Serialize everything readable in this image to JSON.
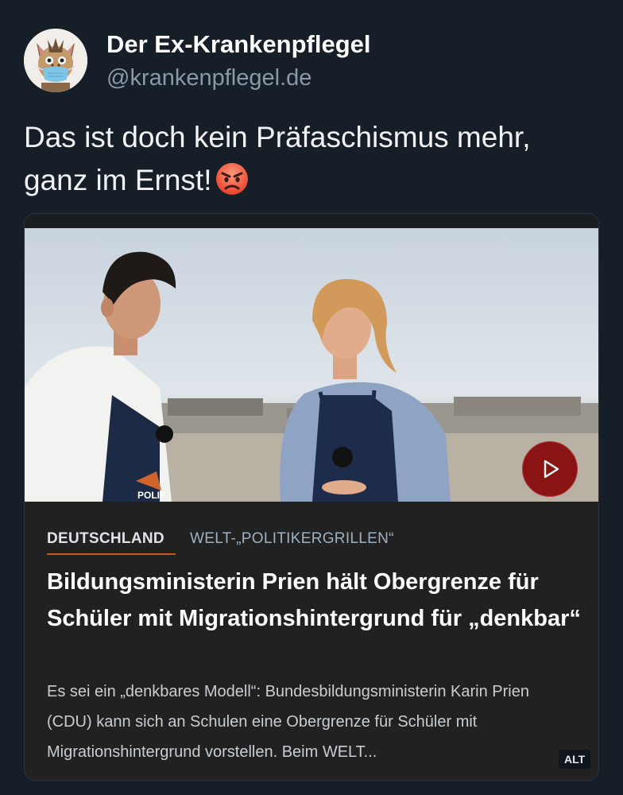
{
  "post": {
    "display_name": "Der Ex-Krankenpflegel",
    "handle": "@krankenpflegel.de",
    "text": "Das ist doch kein Präfaschismus mehr, ganz im Ernst!",
    "emoji": "angry-face-emoji"
  },
  "link_card": {
    "section": "DEUTSCHLAND",
    "subsection": "WELT-„POLITIKERGRILLEN“",
    "headline": "Bildungsministerin Prien hält Obergrenze für Schüler mit Migrationshintergrund für „denkbar“",
    "teaser": "Es sei ein „denkbares Modell“: Bundesbildungsministerin Karin Prien (CDU) kann sich an Schulen eine Obergrenze für Schüler mit Migrationshintergrund vorstellen. Beim WELT...",
    "apron_text": "POLIT",
    "alt_badge": "ALT",
    "play_icon": "play-icon"
  },
  "colors": {
    "background": "#161e27",
    "card": "#212121",
    "accent_underline": "#c85a1d",
    "play_button": "#8a1414"
  }
}
